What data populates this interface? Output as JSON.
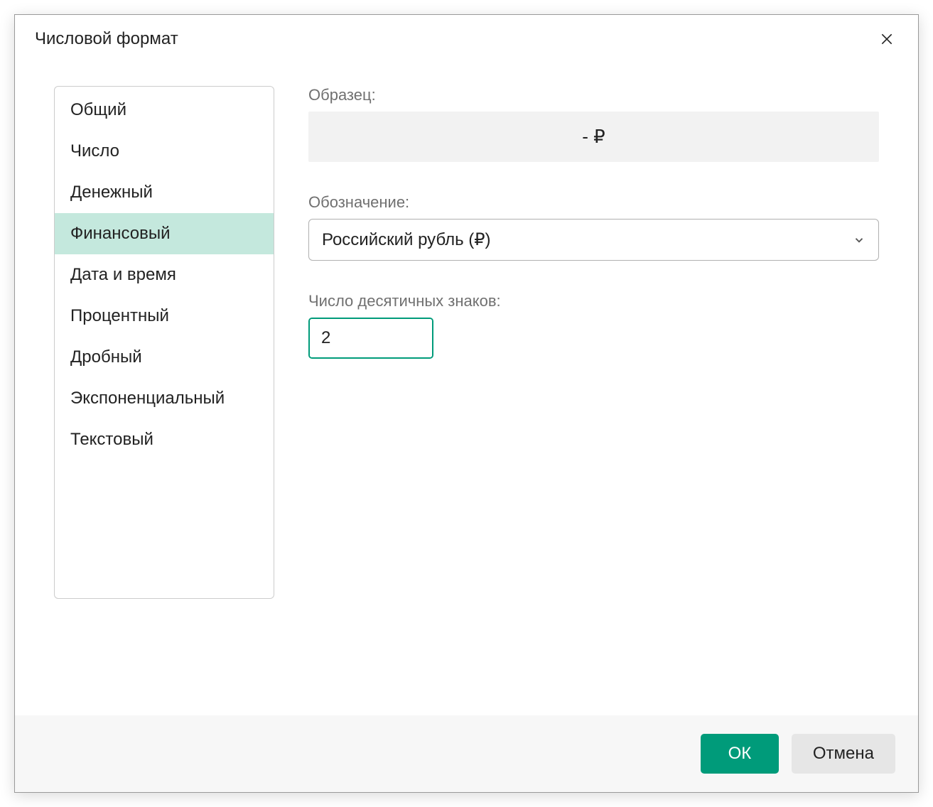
{
  "dialog": {
    "title": "Числовой формат"
  },
  "categories": [
    {
      "label": "Общий"
    },
    {
      "label": "Число"
    },
    {
      "label": "Денежный"
    },
    {
      "label": "Финансовый"
    },
    {
      "label": "Дата и время"
    },
    {
      "label": "Процентный"
    },
    {
      "label": "Дробный"
    },
    {
      "label": "Экспоненциальный"
    },
    {
      "label": "Текстовый"
    }
  ],
  "selectedCategoryIndex": 3,
  "sample": {
    "label": "Образец:",
    "value": "-  ₽"
  },
  "symbol": {
    "label": "Обозначение:",
    "value": "Российский рубль (₽)"
  },
  "decimals": {
    "label": "Число десятичных знаков:",
    "value": "2"
  },
  "buttons": {
    "ok": "ОК",
    "cancel": "Отмена"
  }
}
